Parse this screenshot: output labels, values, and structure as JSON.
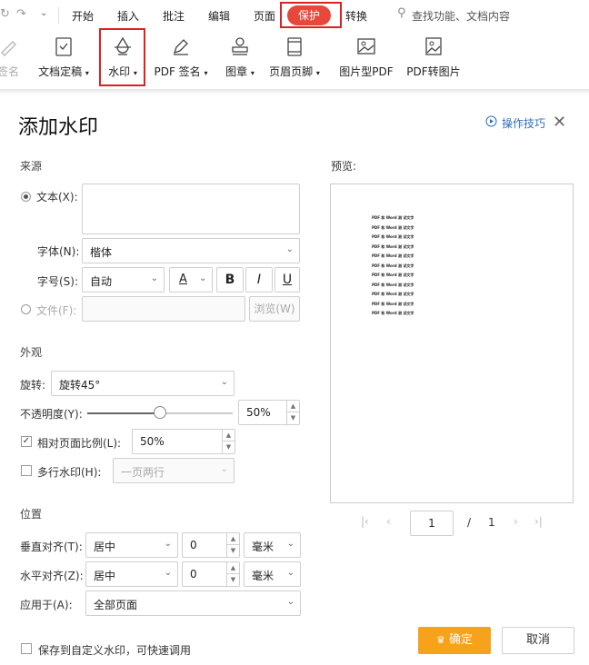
{
  "menubar": {
    "items": [
      "开始",
      "插入",
      "批注",
      "编辑",
      "页面",
      "保护",
      "转换"
    ],
    "active": "保护",
    "search": "查找功能、文档内容"
  },
  "ribbon": {
    "buttons": [
      "签名",
      "文档定稿",
      "水印",
      "PDF 签名",
      "图章",
      "页眉页脚",
      "图片型PDF",
      "PDF转图片"
    ]
  },
  "dialog": {
    "title": "添加水印",
    "tips": "操作技巧",
    "source": {
      "section": "来源",
      "text_label": "文本(X):",
      "text_value": "",
      "font_label": "字体(N):",
      "font_value": "楷体",
      "size_label": "字号(S):",
      "size_value": "自动",
      "color_glyph": "A",
      "bold": "B",
      "italic": "I",
      "underline": "U",
      "file_label": "文件(F):",
      "browse": "浏览(W)"
    },
    "appearance": {
      "section": "外观",
      "rotate_label": "旋转:",
      "rotate_value": "旋转45°",
      "opacity_label": "不透明度(Y):",
      "opacity_value": "50%",
      "opacity_fraction": 0.5,
      "relative_label": "相对页面比例(L):",
      "relative_value": "50%",
      "relative_checked": true,
      "multi_label": "多行水印(H):",
      "multi_value": "一页两行",
      "multi_checked": false
    },
    "position": {
      "section": "位置",
      "v_label": "垂直对齐(T):",
      "v_value": "居中",
      "v_offset": "0",
      "v_unit": "毫米",
      "h_label": "水平对齐(Z):",
      "h_value": "居中",
      "h_offset": "0",
      "h_unit": "毫米",
      "apply_label": "应用于(A):",
      "apply_value": "全部页面"
    },
    "preview": {
      "label": "预览:",
      "line_text": "PDF 和 Word 测 试文字",
      "line_count": 11,
      "page_current": "1",
      "page_sep": "/",
      "page_total": "1"
    },
    "save_label": "保存到自定义水印，可快速调用",
    "ok": "确定",
    "cancel": "取消"
  }
}
